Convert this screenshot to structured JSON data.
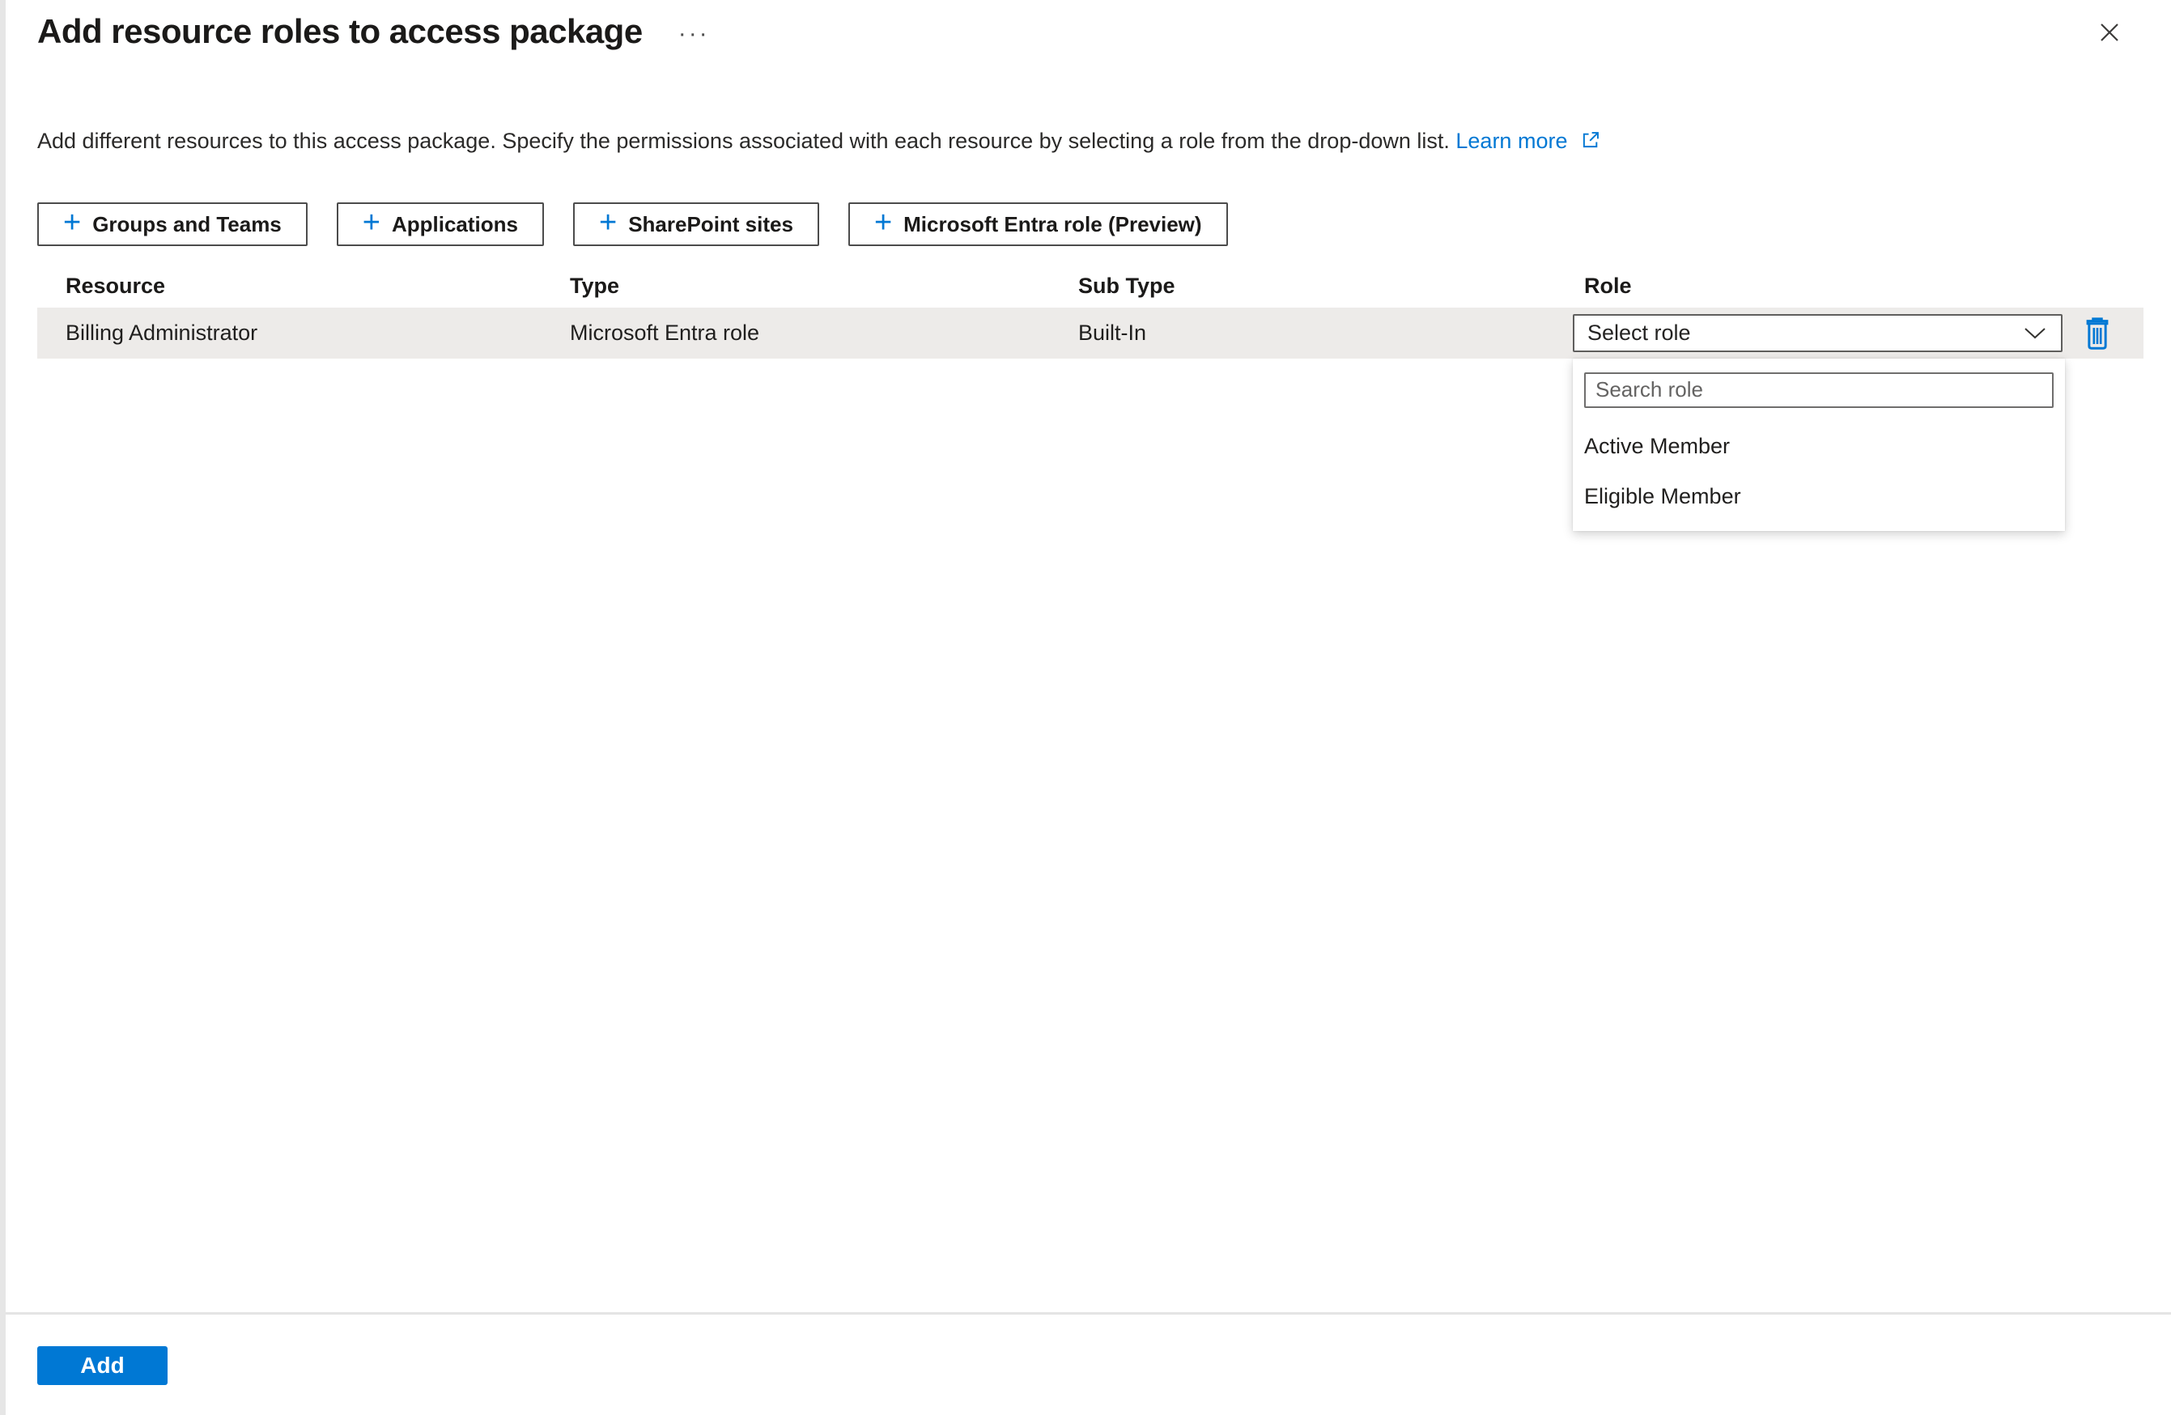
{
  "panel": {
    "title": "Add resource roles to access package",
    "description": "Add different resources to this access package. Specify the permissions associated with each resource by selecting a role from the drop-down list.",
    "learn_more": "Learn more"
  },
  "icons": {
    "plus": "+",
    "more_options": "···"
  },
  "toolbar": {
    "buttons": [
      {
        "label": "Groups and Teams"
      },
      {
        "label": "Applications"
      },
      {
        "label": "SharePoint sites"
      },
      {
        "label": "Microsoft Entra role (Preview)"
      }
    ]
  },
  "table": {
    "columns": [
      "Resource",
      "Type",
      "Sub Type",
      "Role"
    ],
    "rows": [
      {
        "resource": "Billing Administrator",
        "type": "Microsoft Entra role",
        "sub_type": "Built-In",
        "role_value": "Select role"
      }
    ]
  },
  "role_dropdown": {
    "search_placeholder": "Search role",
    "options": [
      {
        "label": "Active Member"
      },
      {
        "label": "Eligible Member"
      }
    ]
  },
  "footer": {
    "add": "Add"
  },
  "colors": {
    "accent": "#0078d4",
    "row_bg": "#edebe9"
  }
}
